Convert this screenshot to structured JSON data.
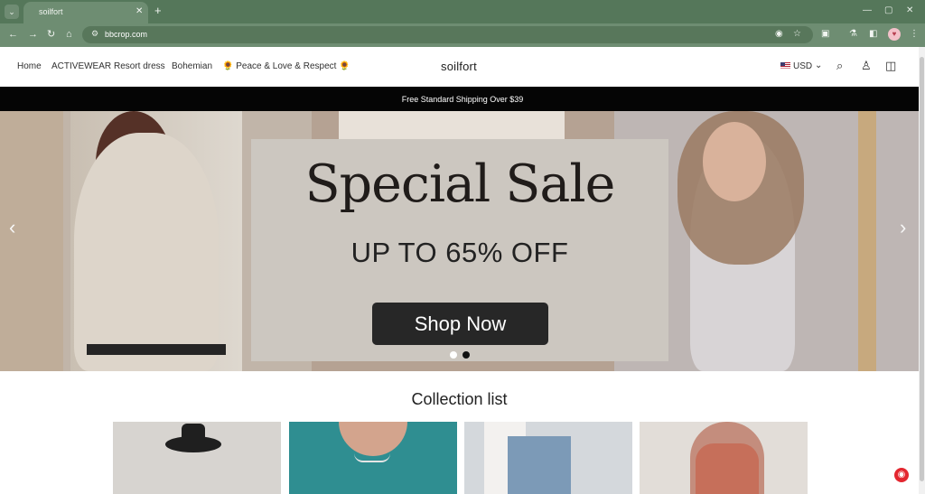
{
  "browser": {
    "tab_title": "soilfort",
    "url": "bbcrop.com",
    "tab_close": "✕",
    "new_tab": "+",
    "profile_initials": "♥"
  },
  "store": {
    "brand": "soilfort",
    "nav": [
      "Home",
      "ACTIVEWEAR",
      "Resort dress",
      "Bohemian",
      "🌻 Peace & Love & Respect 🌻"
    ],
    "currency": "USD",
    "announcement": "Free Standard Shipping Over $39"
  },
  "hero": {
    "title": "Special Sale",
    "subtitle": "UP TO 65% OFF",
    "button": "Shop Now",
    "prev": "‹",
    "next": "›"
  },
  "collection": {
    "title": "Collection list"
  },
  "colors": {
    "browser_frame": "#55775a",
    "announcement": "#050505",
    "button": "#272727"
  },
  "icons": {
    "search": "search-icon",
    "account": "account-icon",
    "cart": "cart-icon",
    "chat": "chat-icon"
  }
}
